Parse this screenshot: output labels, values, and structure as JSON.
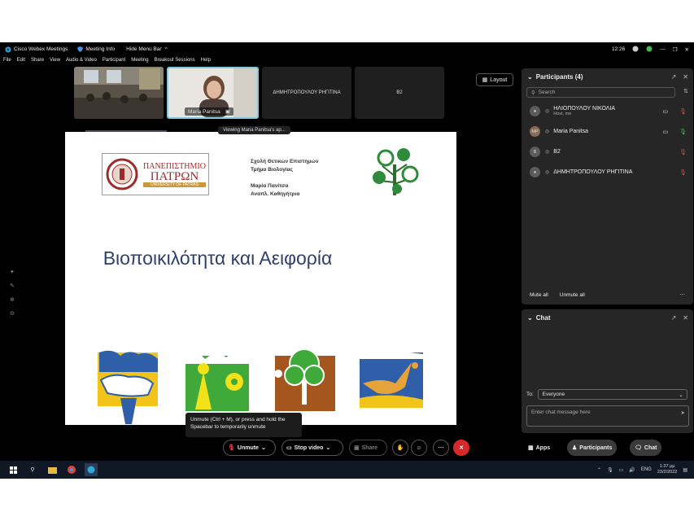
{
  "app": {
    "title": "Cisco Webex Meetings",
    "meeting_info": "Meeting Info",
    "hide_menu_bar": "Hide Menu Bar",
    "clock": "12:26"
  },
  "menu": [
    "File",
    "Edit",
    "Share",
    "View",
    "Audio & Video",
    "Participant",
    "Meeting",
    "Breakout Sessions",
    "Help"
  ],
  "video_tiles": {
    "presenter_name": "Maria Panitsa",
    "tile3": "ΔΗΜΗΤΡΟΠΟΥΛΟΥ ΡΗΓΙΤΙΝΑ",
    "tile4": "B2"
  },
  "layout_label": "Layout",
  "viewing_label": "Viewing Maria Panitsa's ap...",
  "slide": {
    "logo_line1": "ΠΑΝΕΠΙΣΤΗΜΙΟ",
    "logo_line2": "ΠΑΤΡΩΝ",
    "logo_line3": "UNIVERSITY OF PATRAS",
    "school": "Σχολή Θετικών Επιστημών",
    "department": "Τμήμα Βιολογίας",
    "author": "Μαρία Πανίτσα",
    "author_title": "Αναπλ. Καθηγήτρια",
    "title": "Βιοποικιλότητα και Αειφορία"
  },
  "participants": {
    "header": "Participants (4)",
    "search_placeholder": "Search",
    "list": [
      {
        "initials": "",
        "name": "ΗΛΙΟΠΟΥΛΟΥ ΝΙΚΟΛΙΑ",
        "sub": "Host, me",
        "video": true,
        "muted": true
      },
      {
        "initials": "MP",
        "name": "Maria Panitsa",
        "sub": "",
        "video": true,
        "muted": false
      },
      {
        "initials": "B",
        "name": "B2",
        "sub": "",
        "video": false,
        "muted": true
      },
      {
        "initials": "",
        "name": "ΔΗΜΗΤΡΟΠΟΥΛΟΥ ΡΗΓΙΤΙΝΑ",
        "sub": "",
        "video": false,
        "muted": true
      }
    ],
    "mute_all": "Mute all",
    "unmute_all": "Unmute all"
  },
  "chat": {
    "header": "Chat",
    "to_label": "To:",
    "to_value": "Everyone",
    "input_placeholder": "Enter chat message here"
  },
  "tooltip": "Unmute (Ctrl + M), or press and hold the Spacebar to temporarily unmute",
  "controls": {
    "unmute": "Unmute",
    "stop_video": "Stop video",
    "share": "Share",
    "apps": "Apps",
    "participants": "Participants",
    "chat": "Chat"
  },
  "taskbar": {
    "lang": "ENG",
    "time": "1:37 μμ",
    "date": "23/2/2022"
  },
  "colors": {
    "muted": "#e04b4b",
    "unmuted": "#3bbf4a",
    "end_call": "#d62a2a",
    "slide_title": "#2f3f6e"
  }
}
